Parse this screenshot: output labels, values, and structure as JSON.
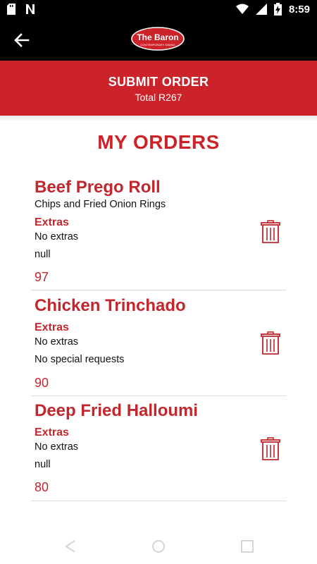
{
  "status_bar": {
    "time": "8:59",
    "icons": [
      "sd-card-icon",
      "n-notification-icon",
      "wifi-icon",
      "cellular-signal-icon",
      "battery-charging-icon"
    ]
  },
  "toolbar": {
    "back_icon": "arrow-left-icon",
    "logo": {
      "main": "The Baron",
      "sub": "CONTEMPORARY DINING"
    }
  },
  "submit": {
    "label": "SUBMIT ORDER",
    "total": "Total R267"
  },
  "page_title": "MY ORDERS",
  "orders": [
    {
      "name": "Beef Prego Roll",
      "side": "Chips and Fried Onion Rings",
      "extras_label": "Extras",
      "extras": "No extras",
      "note": "null",
      "price": "97"
    },
    {
      "name": "Chicken Trinchado",
      "extras_label": "Extras",
      "extras": "No extras",
      "note": "No special requests",
      "price": "90"
    },
    {
      "name": "Deep Fried Halloumi",
      "extras_label": "Extras",
      "extras": "No extras",
      "note": "null",
      "price": "80"
    }
  ],
  "colors": {
    "brand_red": "#cc2229",
    "text_red": "#c1272d",
    "toolbar_bg": "#000000"
  },
  "nav_bar": {
    "icons": [
      "back-triangle-icon",
      "home-circle-icon",
      "recents-square-icon"
    ]
  }
}
